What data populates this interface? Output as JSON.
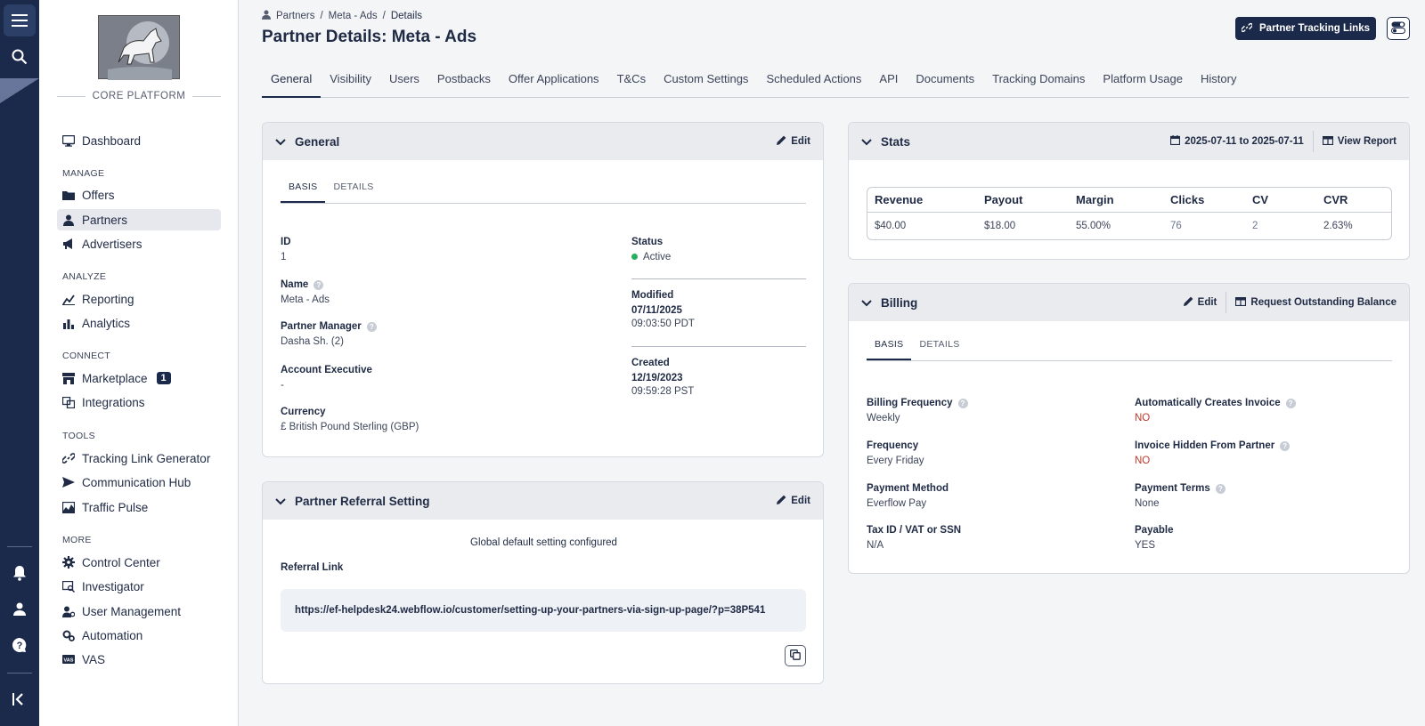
{
  "rail": {
    "icons": [
      "menu-icon",
      "search-icon",
      "bell-icon",
      "user-icon",
      "help-icon",
      "collapse-icon"
    ]
  },
  "sidebar": {
    "platform": "CORE PLATFORM",
    "dashboard": "Dashboard",
    "sections": {
      "manage": "MANAGE",
      "analyze": "ANALYZE",
      "connect": "CONNECT",
      "tools": "TOOLS",
      "more": "MORE"
    },
    "items": {
      "offers": "Offers",
      "partners": "Partners",
      "advertisers": "Advertisers",
      "reporting": "Reporting",
      "analytics": "Analytics",
      "marketplace": "Marketplace",
      "marketplace_badge": "1",
      "integrations": "Integrations",
      "tracking_link_generator": "Tracking Link Generator",
      "communication_hub": "Communication Hub",
      "traffic_pulse": "Traffic Pulse",
      "control_center": "Control Center",
      "investigator": "Investigator",
      "user_management": "User Management",
      "automation": "Automation",
      "vas": "VAS"
    }
  },
  "breadcrumb": {
    "root": "Partners",
    "sep": "/",
    "parent": "Meta - Ads",
    "current": "Details"
  },
  "page_title": "Partner Details: Meta - Ads",
  "header_button": "Partner Tracking Links",
  "tabs": [
    "General",
    "Visibility",
    "Users",
    "Postbacks",
    "Offer Applications",
    "T&Cs",
    "Custom Settings",
    "Scheduled Actions",
    "API",
    "Documents",
    "Tracking Domains",
    "Platform Usage",
    "History"
  ],
  "general_card": {
    "title": "General",
    "edit": "Edit",
    "subtabs": [
      "BASIS",
      "DETAILS"
    ],
    "id_label": "ID",
    "id_value": "1",
    "name_label": "Name",
    "name_value": "Meta - Ads",
    "pm_label": "Partner Manager",
    "pm_value": "Dasha Sh. (2)",
    "ae_label": "Account Executive",
    "ae_value": "-",
    "currency_label": "Currency",
    "currency_value": "£ British Pound Sterling (GBP)",
    "status_label": "Status",
    "status_value": "Active",
    "status_color": "#27ae60",
    "modified_label": "Modified",
    "modified_date": "07/11/2025",
    "modified_time": "09:03:50 PDT",
    "created_label": "Created",
    "created_date": "12/19/2023",
    "created_time": "09:59:28 PST"
  },
  "referral_card": {
    "title": "Partner Referral Setting",
    "edit": "Edit",
    "note": "Global default setting configured",
    "link_label": "Referral Link",
    "link": "https://ef-helpdesk24.webflow.io/customer/setting-up-your-partners-via-sign-up-page/?p=38P541"
  },
  "stats_card": {
    "title": "Stats",
    "date_range": "2025-07-11 to 2025-07-11",
    "view_report": "View Report",
    "headers": [
      "Revenue",
      "Payout",
      "Margin",
      "Clicks",
      "CV",
      "CVR"
    ],
    "values": [
      "$40.00",
      "$18.00",
      "55.00%",
      "76",
      "2",
      "2.63%"
    ]
  },
  "billing_card": {
    "title": "Billing",
    "edit": "Edit",
    "request": "Request Outstanding Balance",
    "subtabs": [
      "BASIS",
      "DETAILS"
    ],
    "bf_label": "Billing Frequency",
    "bf_value": "Weekly",
    "freq_label": "Frequency",
    "freq_value": "Every Friday",
    "pm_label": "Payment Method",
    "pm_value": "Everflow Pay",
    "tax_label": "Tax ID / VAT or SSN",
    "tax_value": "N/A",
    "aci_label": "Automatically Creates Invoice",
    "aci_value": "NO",
    "ihp_label": "Invoice Hidden From Partner",
    "ihp_value": "NO",
    "pt_label": "Payment Terms",
    "pt_value": "None",
    "payable_label": "Payable",
    "payable_value": "YES"
  },
  "colors": {
    "navy": "#1b2a4a",
    "no_red": "#c0392b",
    "active_green": "#27ae60"
  }
}
